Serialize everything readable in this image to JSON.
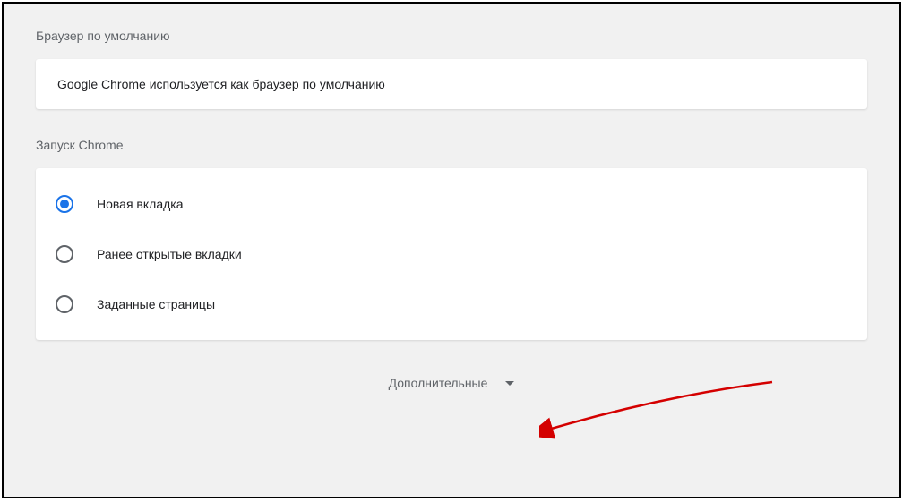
{
  "defaultBrowser": {
    "title": "Браузер по умолчанию",
    "message": "Google Chrome используется как браузер по умолчанию"
  },
  "startup": {
    "title": "Запуск Chrome",
    "options": [
      {
        "label": "Новая вкладка",
        "selected": true
      },
      {
        "label": "Ранее открытые вкладки",
        "selected": false
      },
      {
        "label": "Заданные страницы",
        "selected": false
      }
    ]
  },
  "advanced": {
    "label": "Дополнительные"
  }
}
